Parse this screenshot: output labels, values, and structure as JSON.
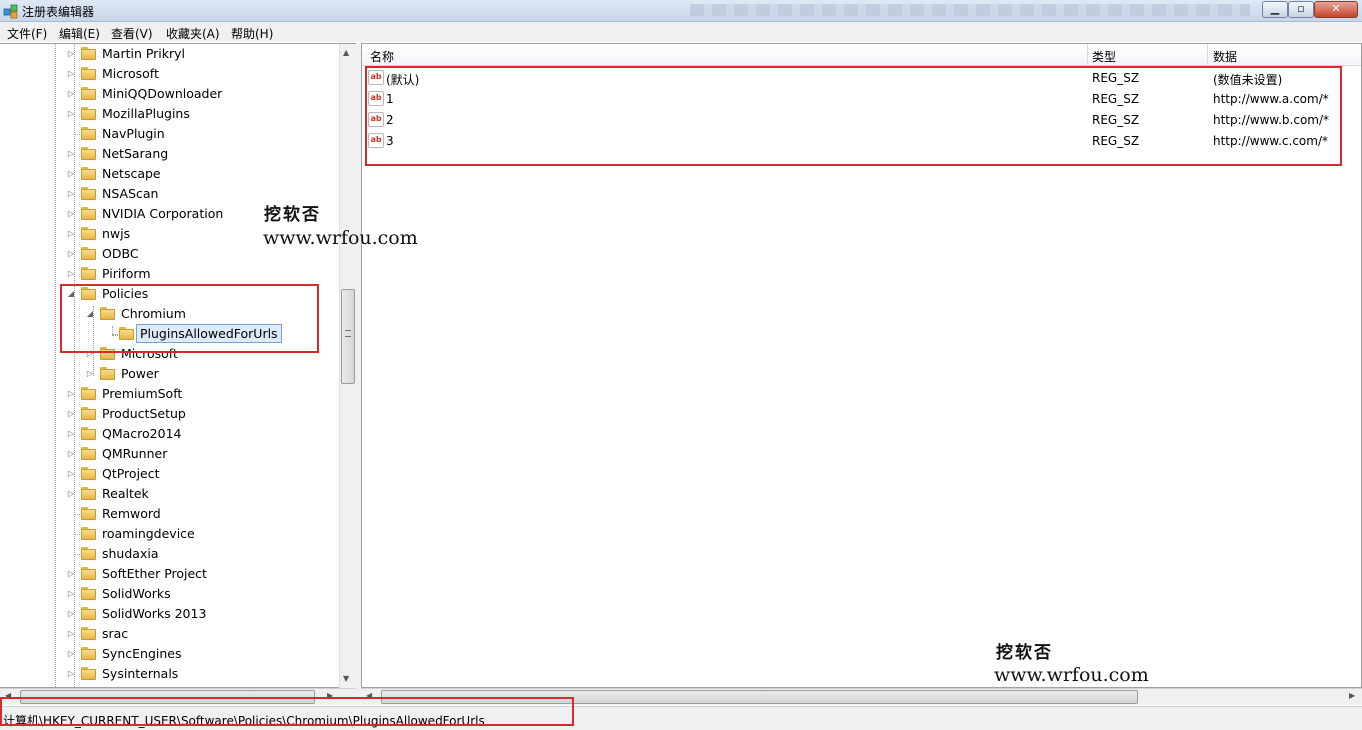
{
  "window": {
    "title": "注册表编辑器"
  },
  "menu": [
    "文件(F)",
    "编辑(E)",
    "查看(V)",
    "收藏夹(A)",
    "帮助(H)"
  ],
  "tree": {
    "items": [
      {
        "label": "Martin Prikryl",
        "level": 0,
        "expander": "collapsed"
      },
      {
        "label": "Microsoft",
        "level": 0,
        "expander": "collapsed"
      },
      {
        "label": "MiniQQDownloader",
        "level": 0,
        "expander": "collapsed"
      },
      {
        "label": "MozillaPlugins",
        "level": 0,
        "expander": "collapsed"
      },
      {
        "label": "NavPlugin",
        "level": 0,
        "expander": "none"
      },
      {
        "label": "NetSarang",
        "level": 0,
        "expander": "collapsed"
      },
      {
        "label": "Netscape",
        "level": 0,
        "expander": "collapsed"
      },
      {
        "label": "NSAScan",
        "level": 0,
        "expander": "collapsed"
      },
      {
        "label": "NVIDIA Corporation",
        "level": 0,
        "expander": "collapsed"
      },
      {
        "label": "nwjs",
        "level": 0,
        "expander": "collapsed"
      },
      {
        "label": "ODBC",
        "level": 0,
        "expander": "collapsed"
      },
      {
        "label": "Piriform",
        "level": 0,
        "expander": "collapsed"
      },
      {
        "label": "Policies",
        "level": 0,
        "expander": "expanded"
      },
      {
        "label": "Chromium",
        "level": 1,
        "expander": "expanded"
      },
      {
        "label": "PluginsAllowedForUrls",
        "level": 2,
        "expander": "none",
        "selected": true
      },
      {
        "label": "Microsoft",
        "level": 1,
        "expander": "collapsed"
      },
      {
        "label": "Power",
        "level": 1,
        "expander": "collapsed"
      },
      {
        "label": "PremiumSoft",
        "level": 0,
        "expander": "collapsed"
      },
      {
        "label": "ProductSetup",
        "level": 0,
        "expander": "collapsed"
      },
      {
        "label": "QMacro2014",
        "level": 0,
        "expander": "collapsed"
      },
      {
        "label": "QMRunner",
        "level": 0,
        "expander": "collapsed"
      },
      {
        "label": "QtProject",
        "level": 0,
        "expander": "collapsed"
      },
      {
        "label": "Realtek",
        "level": 0,
        "expander": "collapsed"
      },
      {
        "label": "Remword",
        "level": 0,
        "expander": "none"
      },
      {
        "label": "roamingdevice",
        "level": 0,
        "expander": "none"
      },
      {
        "label": "shudaxia",
        "level": 0,
        "expander": "none"
      },
      {
        "label": "SoftEther Project",
        "level": 0,
        "expander": "collapsed"
      },
      {
        "label": "SolidWorks",
        "level": 0,
        "expander": "collapsed"
      },
      {
        "label": "SolidWorks 2013",
        "level": 0,
        "expander": "collapsed"
      },
      {
        "label": "srac",
        "level": 0,
        "expander": "collapsed"
      },
      {
        "label": "SyncEngines",
        "level": 0,
        "expander": "collapsed"
      },
      {
        "label": "Sysinternals",
        "level": 0,
        "expander": "collapsed"
      }
    ]
  },
  "list": {
    "columns": {
      "name": "名称",
      "type": "类型",
      "data": "数据"
    },
    "rows": [
      {
        "name": "(默认)",
        "type": "REG_SZ",
        "data": "(数值未设置)"
      },
      {
        "name": "1",
        "type": "REG_SZ",
        "data": "http://www.a.com/*"
      },
      {
        "name": "2",
        "type": "REG_SZ",
        "data": "http://www.b.com/*"
      },
      {
        "name": "3",
        "type": "REG_SZ",
        "data": "http://www.c.com/*"
      }
    ],
    "value_icon": "ab"
  },
  "status": {
    "path": "计算机\\HKEY_CURRENT_USER\\Software\\Policies\\Chromium\\PluginsAllowedForUrls"
  },
  "watermark": {
    "name": "挖软否",
    "url": "www.wrfou.com"
  },
  "colors": {
    "annotation_red": "#d62b2b",
    "folder_yellow": "#e3b64b",
    "selection_blue": "#dceaf9"
  }
}
